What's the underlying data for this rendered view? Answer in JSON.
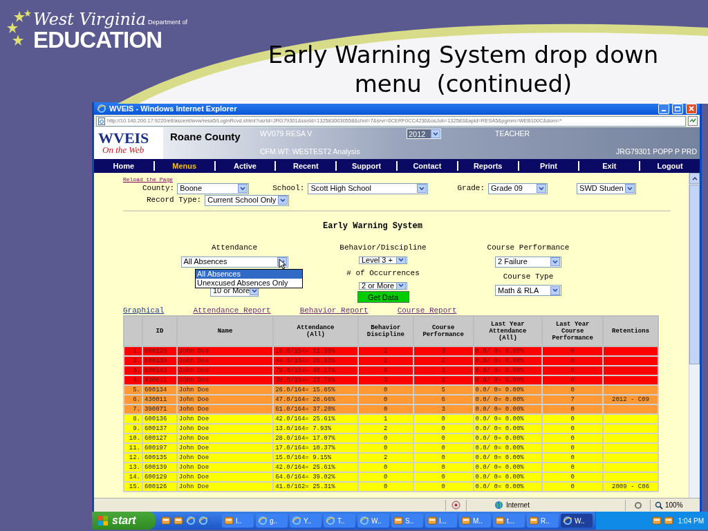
{
  "slide": {
    "title": "Early Warning System drop down menu  (continued)",
    "logo": {
      "script": "West Virginia",
      "dept": "Department of",
      "word": "EDUCATION"
    }
  },
  "window": {
    "title": "WVEIS - Windows Internet Explorer",
    "address": "http://10.140.200.17:9220/etl/ascent/wvw/resa5/LoginRcvd.shtml?usrId=JRG79301&ssnId=1325830030558&chnl=7&srvr=0CERF0CC4230&osJob=132583&apid=RESA5&pgmm=WEB100C&dom=*"
  },
  "header": {
    "logo": "WVEIS",
    "logo_sub": "On the Web",
    "county": "Roane County",
    "resa": "WV079 RESA V",
    "analysis": "CFM.WT: WESTEST2 Analysis",
    "year": "2012",
    "role": "TEACHER",
    "user": "JRG79301 POPP P PRD"
  },
  "nav": [
    {
      "label": "Home",
      "selected": false
    },
    {
      "label": "Menus",
      "selected": true
    },
    {
      "label": "Active",
      "selected": false
    },
    {
      "label": "Recent",
      "selected": false
    },
    {
      "label": "Support",
      "selected": false
    },
    {
      "label": "Contact",
      "selected": false
    },
    {
      "label": "Reports",
      "selected": false
    },
    {
      "label": "Print",
      "selected": false
    },
    {
      "label": "Exit",
      "selected": false
    },
    {
      "label": "Logout",
      "selected": false
    }
  ],
  "reload_link": "Reload the Page",
  "filters": {
    "county_label": "County:",
    "county": "Boone",
    "school_label": "School:",
    "school": "Scott High School",
    "grade_label": "Grade:",
    "grade": "Grade 09",
    "swd": "SWD Studen",
    "record_label": "Record Type:",
    "record": "Current School Only"
  },
  "ews": {
    "title": "Early Warning System",
    "attendance_label": "Attendance",
    "attendance": "All Absences",
    "attendance_options": [
      {
        "label": "All Absences",
        "selected": true
      },
      {
        "label": "Unexcused Absences Only",
        "selected": false
      }
    ],
    "attendance_count": "10 or More",
    "behavior_label": "Behavior/Discipline",
    "behavior": "Level 3 +",
    "occurrences_label": "# of Occurrences",
    "occurrences": "2 or More",
    "course_label": "Course Performance",
    "course": "2 Failure",
    "course_type_label": "Course Type",
    "course_type": "Math & RLA",
    "button": "Get Data"
  },
  "report_links": [
    "Graphical",
    "Attendance Report",
    "Behavior Report",
    "Course Report"
  ],
  "table": {
    "columns": [
      "",
      "ID",
      "Name",
      "Attendance\n(All)",
      "Behavior\nDiscipline",
      "Course\nPerformance",
      "Last Year\nAttendance\n(All)",
      "Last Year\nCourse\nPerformance",
      "Retentions"
    ],
    "rows": [
      {
        "kind": "high",
        "cells": [
          "1.",
          "600128",
          "John Doe",
          "19.0/164= 11.59%",
          "2",
          "3",
          "0.0/ 0= 0.00%",
          "0"
        ]
      },
      {
        "kind": "high",
        "cells": [
          "2.",
          "600138",
          "John Doe",
          "44.0/164= 26.83%",
          "2",
          "2",
          "0.0/ 0= 0.00%",
          "0"
        ]
      },
      {
        "kind": "high",
        "cells": [
          "3.",
          "600143",
          "John Doe",
          "79.0/164= 48.17%",
          "6",
          "3",
          "0.0/ 0= 0.00%",
          "0"
        ]
      },
      {
        "kind": "high",
        "cells": [
          "4.",
          "430011",
          "John Doe",
          "39.0/164= 23.78%",
          "3",
          "2",
          "0.0/ 0= 0.00%",
          "0"
        ]
      },
      {
        "kind": "medium",
        "cells": [
          "5.",
          "600134",
          "John Doe",
          "26.0/164= 15.85%",
          "0",
          "5",
          "0.0/ 0= 0.00%",
          "0"
        ]
      },
      {
        "kind": "medium",
        "cells": [
          "6.",
          "430011",
          "John Doe",
          "47.0/164= 28.66%",
          "0",
          "6",
          "0.0/ 0= 0.00%",
          "7",
          "2012 - C09"
        ]
      },
      {
        "kind": "medium",
        "cells": [
          "7.",
          "390071",
          "John Doe",
          "61.0/164= 37.20%",
          "0",
          "3",
          "0.0/ 0= 0.00%",
          "0"
        ]
      },
      {
        "kind": "low",
        "cells": [
          "8.",
          "600136",
          "John Doe",
          "42.0/164= 25.61%",
          "1",
          "0",
          "0.0/ 0= 0.00%",
          "0"
        ]
      },
      {
        "kind": "low",
        "cells": [
          "9.",
          "600137",
          "John Doe",
          "13.0/164= 7.93%",
          "2",
          "0",
          "0.0/ 0= 0.00%",
          "0"
        ]
      },
      {
        "kind": "low",
        "cells": [
          "10.",
          "600127",
          "John Doe",
          "28.0/164= 17.07%",
          "0",
          "0",
          "0.0/ 0= 0.00%",
          "0"
        ]
      },
      {
        "kind": "low",
        "cells": [
          "11.",
          "600197",
          "John Doe",
          "17.0/164= 10.37%",
          "0",
          "0",
          "0.0/ 0= 0.00%",
          "0"
        ]
      },
      {
        "kind": "low",
        "cells": [
          "12.",
          "600135",
          "John Doe",
          "15.0/164= 9.15%",
          "2",
          "0",
          "0.0/ 0= 0.00%",
          "0"
        ]
      },
      {
        "kind": "low",
        "cells": [
          "13.",
          "600139",
          "John Doe",
          "42.0/164= 25.61%",
          "0",
          "0",
          "0.0/ 0= 0.00%",
          "0"
        ]
      },
      {
        "kind": "low",
        "cells": [
          "14.",
          "600129",
          "John Doe",
          "64.0/164= 39.02%",
          "0",
          "0",
          "0.0/ 0= 0.00%",
          "0"
        ]
      },
      {
        "kind": "low",
        "cells": [
          "15.",
          "600126",
          "John Doe",
          "41.0/162= 25.31%",
          "0",
          "0",
          "0.0/ 0= 0.00%",
          "0",
          "2009 - C06"
        ]
      }
    ]
  },
  "status_bar": {
    "zone": "Internet",
    "zoom": "100%"
  },
  "taskbar": {
    "start": "start",
    "tasks": [
      {
        "label": "I..",
        "kind": "app",
        "selected": false
      },
      {
        "label": "g..",
        "kind": "browser",
        "selected": false
      },
      {
        "label": "Y..",
        "kind": "browser",
        "selected": false
      },
      {
        "label": "T..",
        "kind": "browser",
        "selected": false
      },
      {
        "label": "W..",
        "kind": "browser",
        "selected": false
      },
      {
        "label": "S..",
        "kind": "app",
        "selected": false
      },
      {
        "label": "I...",
        "kind": "app",
        "selected": false
      },
      {
        "label": "M..",
        "kind": "app",
        "selected": false
      },
      {
        "label": "t...",
        "kind": "app",
        "selected": false
      },
      {
        "label": "R..",
        "kind": "app",
        "selected": false
      },
      {
        "label": "W..",
        "kind": "browser",
        "selected": true
      }
    ],
    "clock": "1:04 PM"
  }
}
